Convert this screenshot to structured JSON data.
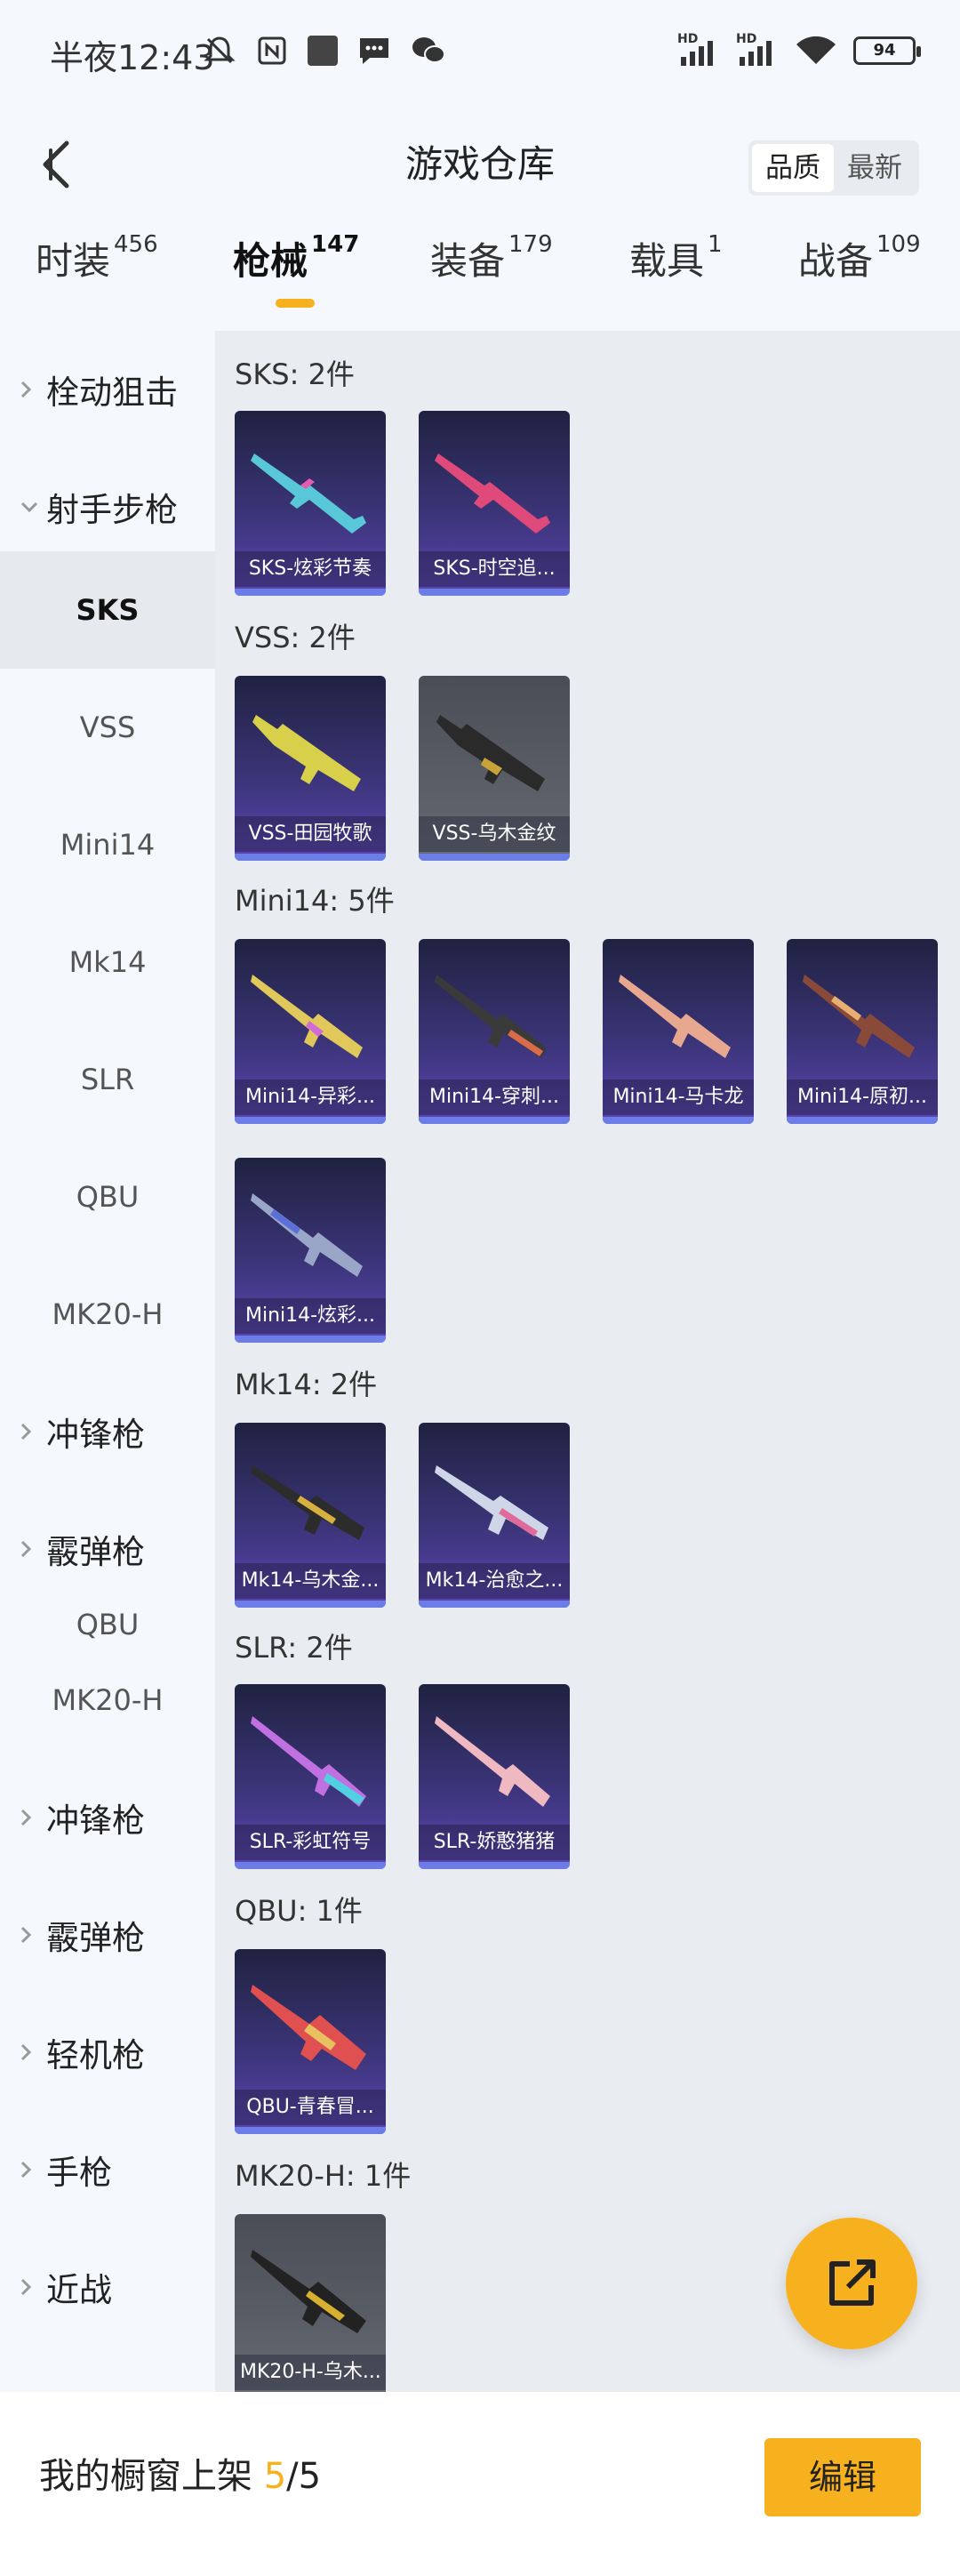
{
  "status_bar": {
    "time": "半夜12:43",
    "hd1": "HD",
    "hd2": "HD",
    "battery": "94"
  },
  "header": {
    "title": "游戏仓库",
    "sort_quality": "品质",
    "sort_latest": "最新"
  },
  "tabs": [
    {
      "label": "时装",
      "count": "456"
    },
    {
      "label": "枪械",
      "count": "147"
    },
    {
      "label": "装备",
      "count": "179"
    },
    {
      "label": "载具",
      "count": "1"
    },
    {
      "label": "战备",
      "count": "109"
    }
  ],
  "sidebar": {
    "items": [
      {
        "label": "栓动狙击"
      },
      {
        "label": "射手步枪"
      },
      {
        "label": "SKS"
      },
      {
        "label": "VSS"
      },
      {
        "label": "Mini14"
      },
      {
        "label": "Mk14"
      },
      {
        "label": "SLR"
      },
      {
        "label": "QBU"
      },
      {
        "label": "MK20-H"
      },
      {
        "label": "冲锋枪"
      },
      {
        "label": "霰弹枪"
      },
      {
        "label": "QBU"
      },
      {
        "label": "MK20-H"
      },
      {
        "label": "冲锋枪"
      },
      {
        "label": "霰弹枪"
      },
      {
        "label": "轻机枪"
      },
      {
        "label": "手枪"
      },
      {
        "label": "近战"
      }
    ]
  },
  "sections": [
    {
      "title": "SKS: 2件",
      "items": [
        "SKS-炫彩节奏",
        "SKS-时空追..."
      ]
    },
    {
      "title": "VSS: 2件",
      "items": [
        "VSS-田园牧歌",
        "VSS-乌木金纹"
      ]
    },
    {
      "title": "Mini14: 5件",
      "items": [
        "Mini14-异彩...",
        "Mini14-穿刺...",
        "Mini14-马卡龙",
        "Mini14-原初...",
        "Mini14-炫彩..."
      ]
    },
    {
      "title": "Mk14: 2件",
      "items": [
        "Mk14-乌木金...",
        "Mk14-治愈之..."
      ]
    },
    {
      "title": "SLR: 2件",
      "items": [
        "SLR-彩虹符号",
        "SLR-娇憨猪猪"
      ]
    },
    {
      "title": "QBU: 1件",
      "items": [
        "QBU-青春冒..."
      ]
    },
    {
      "title": "MK20-H: 1件",
      "items": [
        "MK20-H-乌木..."
      ]
    }
  ],
  "bottom": {
    "label": "我的橱窗上架",
    "current": "5",
    "total": "/5",
    "edit_button": "编辑"
  },
  "colors": {
    "accent": "#f7b11e",
    "card_purple": "#3b3478",
    "card_grey": "#5a5e66"
  }
}
